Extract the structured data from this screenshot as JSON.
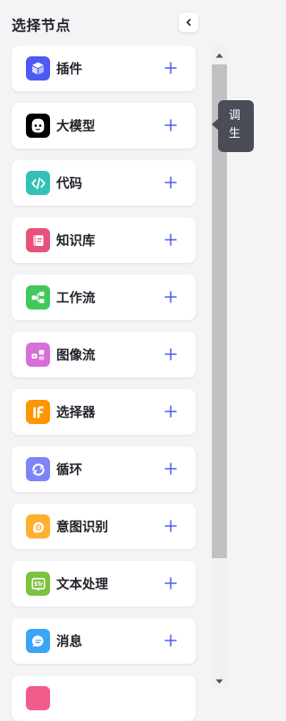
{
  "header": {
    "title": "选择节点"
  },
  "nodes": [
    {
      "label": "插件",
      "icon": "plugin-cube-icon",
      "color": "#4e5bf2"
    },
    {
      "label": "大模型",
      "icon": "llm-robot-icon",
      "color": "#000000"
    },
    {
      "label": "代码",
      "icon": "code-icon",
      "color": "#33c0b6"
    },
    {
      "label": "知识库",
      "icon": "knowledge-base-icon",
      "color": "#e8527a"
    },
    {
      "label": "工作流",
      "icon": "workflow-icon",
      "color": "#3fc95c"
    },
    {
      "label": "图像流",
      "icon": "image-flow-icon",
      "color": "#d66fd8"
    },
    {
      "label": "选择器",
      "icon": "if-selector-icon",
      "color": "#ff9500"
    },
    {
      "label": "循环",
      "icon": "loop-icon",
      "color": "#7e84f7"
    },
    {
      "label": "意图识别",
      "icon": "intent-recognition-icon",
      "color": "#ffb02e"
    },
    {
      "label": "文本处理",
      "icon": "text-processing-icon",
      "color": "#7cc23f"
    },
    {
      "label": "消息",
      "icon": "message-icon",
      "color": "#3aa5f5"
    },
    {
      "label": "",
      "icon": "partial-node-icon",
      "color": "#f25c8a"
    }
  ],
  "tooltip": {
    "line1": "调",
    "line2": "生"
  },
  "colors": {
    "accent": "#4e5bf2",
    "background": "#f4f4f7"
  }
}
